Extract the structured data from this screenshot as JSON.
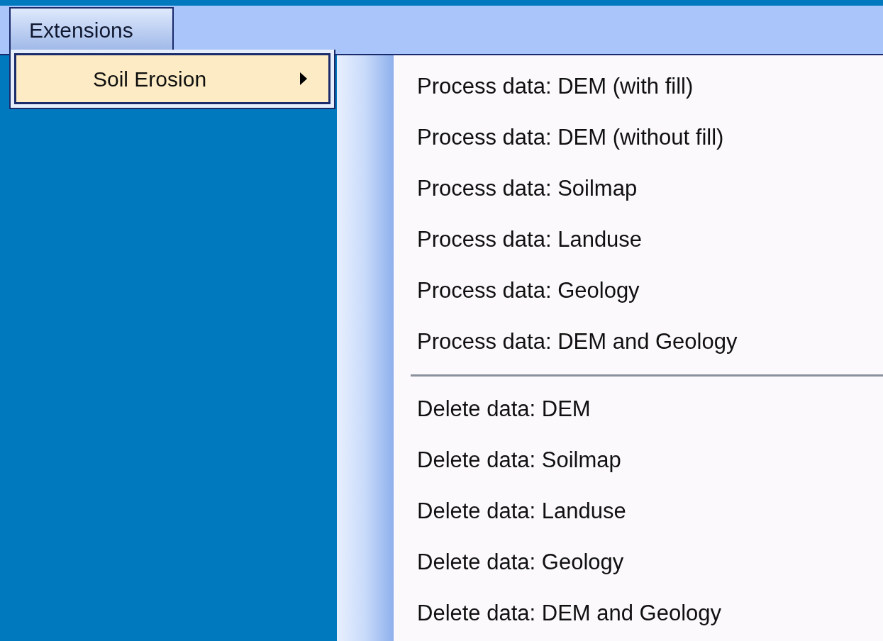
{
  "menu_bar": [
    {
      "label": "Extensions",
      "selected": true
    }
  ],
  "dropdown": [
    {
      "label": "Soil Erosion",
      "selected": true,
      "has_submenu": true
    }
  ],
  "submenu": [
    {
      "kind": "item",
      "label": "Process data: DEM (with fill)"
    },
    {
      "kind": "item",
      "label": "Process data: DEM (without fill)"
    },
    {
      "kind": "item",
      "label": "Process data: Soilmap"
    },
    {
      "kind": "item",
      "label": "Process data: Landuse"
    },
    {
      "kind": "item",
      "label": "Process data: Geology"
    },
    {
      "kind": "item",
      "label": "Process data: DEM and Geology"
    },
    {
      "kind": "separator"
    },
    {
      "kind": "item",
      "label": "Delete data: DEM"
    },
    {
      "kind": "item",
      "label": "Delete data: Soilmap"
    },
    {
      "kind": "item",
      "label": "Delete data: Landuse"
    },
    {
      "kind": "item",
      "label": "Delete data: Geology"
    },
    {
      "kind": "item",
      "label": "Delete data: DEM and Geology"
    }
  ]
}
